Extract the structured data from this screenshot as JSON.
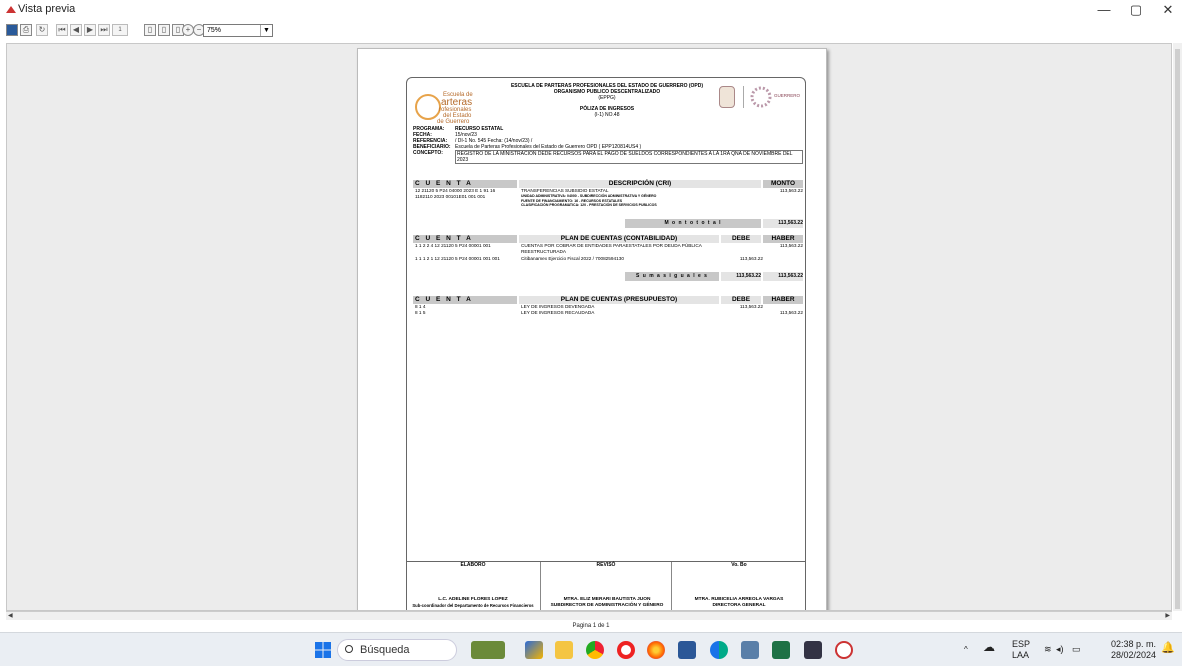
{
  "window": {
    "title": "Vista previa",
    "minimize": "—",
    "maximize": "▢",
    "close": "✕"
  },
  "toolbar": {
    "zoom_value": "75%",
    "page_field": "1"
  },
  "document": {
    "header": {
      "line1": "ESCUELA DE PARTERAS PROFESIONALES DEL ESTADO DE GUERRERO (OPD)",
      "line2": "ORGANISMO PUBLICO DESCENTRALIZADO",
      "line3": "(EPPG)",
      "line4": "PÓLIZA DE INGRESOS",
      "line5": "(I-1) NO.48"
    },
    "logo": {
      "l1": "Escuela de",
      "l2": "arteras",
      "l3": "rofesionales",
      "l4": "del Estado",
      "l5": "de Guerrero"
    },
    "seal2_text": "GUERRERO",
    "meta": [
      {
        "k": "PROGRAMA:",
        "v": "RECURSO ESTATAL"
      },
      {
        "k": "FECHA:",
        "v": "15/nov/23"
      },
      {
        "k": "REFERENCIA:",
        "v": "/ DI-1 No. 545   Fecha: (14/nov/23) /"
      },
      {
        "k": "BENEFICIARIO:",
        "v": "Escuela de Parteras Profesionales del Estado de Guerrero OPD ( EPP120814US4 )"
      },
      {
        "k": "CONCEPTO:",
        "v": "REGISTRO DE LA MINISTRACION DEDE RECURSOS PARA EL PAGO DE SUELDOS CORRESPONDIENTES A LA 1RA QNA DE NOVIEMBRE DEL 2023"
      }
    ],
    "sec1": {
      "h_cuenta": "C U E N T A",
      "h_desc": "DESCRIPCIÓN (CRI)",
      "h_monto": "MONTO",
      "rows": [
        {
          "c1": "12 21120 5 P24 04000 2023 E 1 91 16",
          "c2": "TRANSFERENCIAS SUBSIDIO ESTATAL",
          "c4": "113,563.22"
        },
        {
          "c1": "1182110 2023 00101E01 001 001",
          "c2": "UNIDAD ADMINISTRATIVA: 04000 - SUBDIRECCIÓN ADMINISTRATIVA Y GÉNERO",
          "c4": ""
        },
        {
          "c1": "",
          "c2": "FUENTE DE FINANCIAMIENTO: 16 - RECURSOS ESTATALES",
          "c4": ""
        },
        {
          "c1": "",
          "c2": "CLASIFICACIÓN PROGRAMATICA: 120 - PRESTACIÓN DE SERVICIOS PUBLICOS",
          "c4": ""
        }
      ],
      "total_label": "M o n t o   t o t a l",
      "total_value": "113,563.22"
    },
    "sec2": {
      "h_cuenta": "C U E N T A",
      "h_desc": "PLAN DE CUENTAS (CONTABILIDAD)",
      "h_debe": "DEBE",
      "h_haber": "HABER",
      "rows": [
        {
          "c1": "1 1 2 2 4 12 21120 5 P24 00001 001",
          "c2": "CUENTAS POR COBRAR DE ENTIDADES PARAESTATALES POR DEUDA PÚBLICA REESTRUCTURADA",
          "c3": "",
          "c4": "113,563.22"
        },
        {
          "c1": "1 1 1 2 1 12 21120 5 P24 00001 001 001",
          "c2": "Citibanamex Ejercicio Fiscal 2022 / 70082594130",
          "c3": "113,563.22",
          "c4": ""
        }
      ],
      "sum_label": "S u m a s   i g u a l e s",
      "sum_debe": "113,563.22",
      "sum_haber": "113,563.22"
    },
    "sec3": {
      "h_cuenta": "C U E N T A",
      "h_desc": "PLAN DE CUENTAS (PRESUPUESTO)",
      "h_debe": "DEBE",
      "h_haber": "HABER",
      "rows": [
        {
          "c1": "8 1 4",
          "c2": "LEY DE INGRESOS DEVENGADA",
          "c3": "113,563.22",
          "c4": ""
        },
        {
          "c1": "8 1 5",
          "c2": "LEY DE INGRESOS RECAUDADA",
          "c3": "",
          "c4": "113,563.22"
        }
      ]
    },
    "signatures": [
      {
        "h": "ELABORO",
        "n1": "L.C. ADELINE FLORES LOPEZ",
        "n2": "Sub-coordinador del Departamento de Recursos Financieros"
      },
      {
        "h": "REVISÓ",
        "n1": "MTRA. ELIZ MERARI BAUTISTA JUON",
        "n2": "SUBDIRECTOR DE ADMINISTRACIÓN Y GÉNERO"
      },
      {
        "h": "Vo. Bo",
        "n1": "MTRA. RUBICELIA ARREOLA VARGAS",
        "n2": "DIRECTORA GENERAL"
      }
    ]
  },
  "status": {
    "page_label": "Pagina 1 de 1"
  },
  "taskbar": {
    "search_placeholder": "Búsqueda",
    "lang1": "ESP",
    "lang2": "LAA",
    "time": "02:38 p. m.",
    "date": "28/02/2024"
  },
  "colors": {
    "accent": "#e7a34a",
    "windows_blue": "#1a73e8"
  }
}
